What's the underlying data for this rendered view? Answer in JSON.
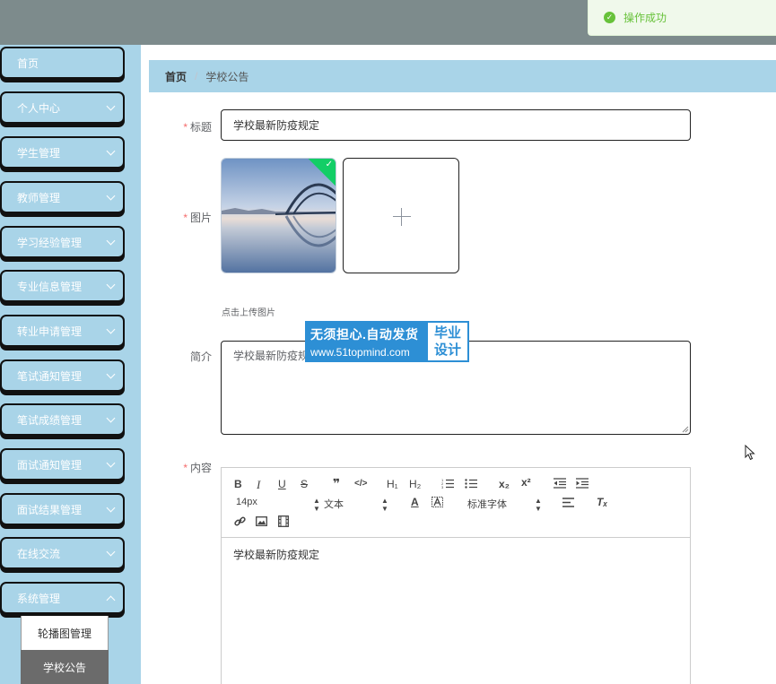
{
  "toast": {
    "message": "操作成功",
    "icon": "check-circle-icon",
    "color": "#67c23a"
  },
  "sidebar": {
    "items": [
      {
        "label": "首页",
        "has_arrow": false
      },
      {
        "label": "个人中心",
        "has_arrow": true
      },
      {
        "label": "学生管理",
        "has_arrow": true
      },
      {
        "label": "教师管理",
        "has_arrow": true
      },
      {
        "label": "学习经验管理",
        "has_arrow": true
      },
      {
        "label": "专业信息管理",
        "has_arrow": true
      },
      {
        "label": "转业申请管理",
        "has_arrow": true
      },
      {
        "label": "笔试通知管理",
        "has_arrow": true
      },
      {
        "label": "笔试成绩管理",
        "has_arrow": true
      },
      {
        "label": "面试通知管理",
        "has_arrow": true
      },
      {
        "label": "面试结果管理",
        "has_arrow": true
      },
      {
        "label": "在线交流",
        "has_arrow": true
      },
      {
        "label": "系统管理",
        "has_arrow": true,
        "open": true
      }
    ],
    "submenu": [
      {
        "label": "轮播图管理",
        "active": false
      },
      {
        "label": "学校公告",
        "active": true
      }
    ],
    "colors": {
      "bg": "#a9d4e8",
      "active_sub": "#6b6b6b"
    }
  },
  "breadcrumb": {
    "home": "首页",
    "separator": "/",
    "current": "学校公告"
  },
  "form": {
    "title": {
      "label": "标题",
      "required": true,
      "value": "学校最新防疫规定"
    },
    "image": {
      "label": "图片",
      "required": true,
      "upload_tip": "点击上传图片"
    },
    "intro": {
      "label": "简介",
      "required": false,
      "value": "学校最新防疫规定"
    },
    "content": {
      "label": "内容",
      "required": true,
      "value": "学校最新防疫规定"
    }
  },
  "editor": {
    "font_size": "14px",
    "block_format": "文本",
    "font_family": "标准字体",
    "buttons": [
      "bold",
      "italic",
      "underline",
      "strikethrough",
      "blockquote",
      "code",
      "h1",
      "h2",
      "ordered-list",
      "bullet-list",
      "subscript",
      "superscript",
      "outdent",
      "indent",
      "font-color",
      "background-color",
      "align",
      "clear-format",
      "link",
      "image",
      "video"
    ],
    "labels": {
      "bold": "B",
      "italic": "I",
      "underline": "U",
      "strike": "S",
      "quote": "❞",
      "code": "</>",
      "h1": "H₁",
      "h2": "H₂",
      "sub": "x₂",
      "sup": "x²",
      "clear": "Tₓ",
      "color": "A"
    }
  },
  "watermark": {
    "line1": "无须担心.自动发货",
    "line2": "www.51topmind.com",
    "badge1": "毕业",
    "badge2": "设计"
  }
}
